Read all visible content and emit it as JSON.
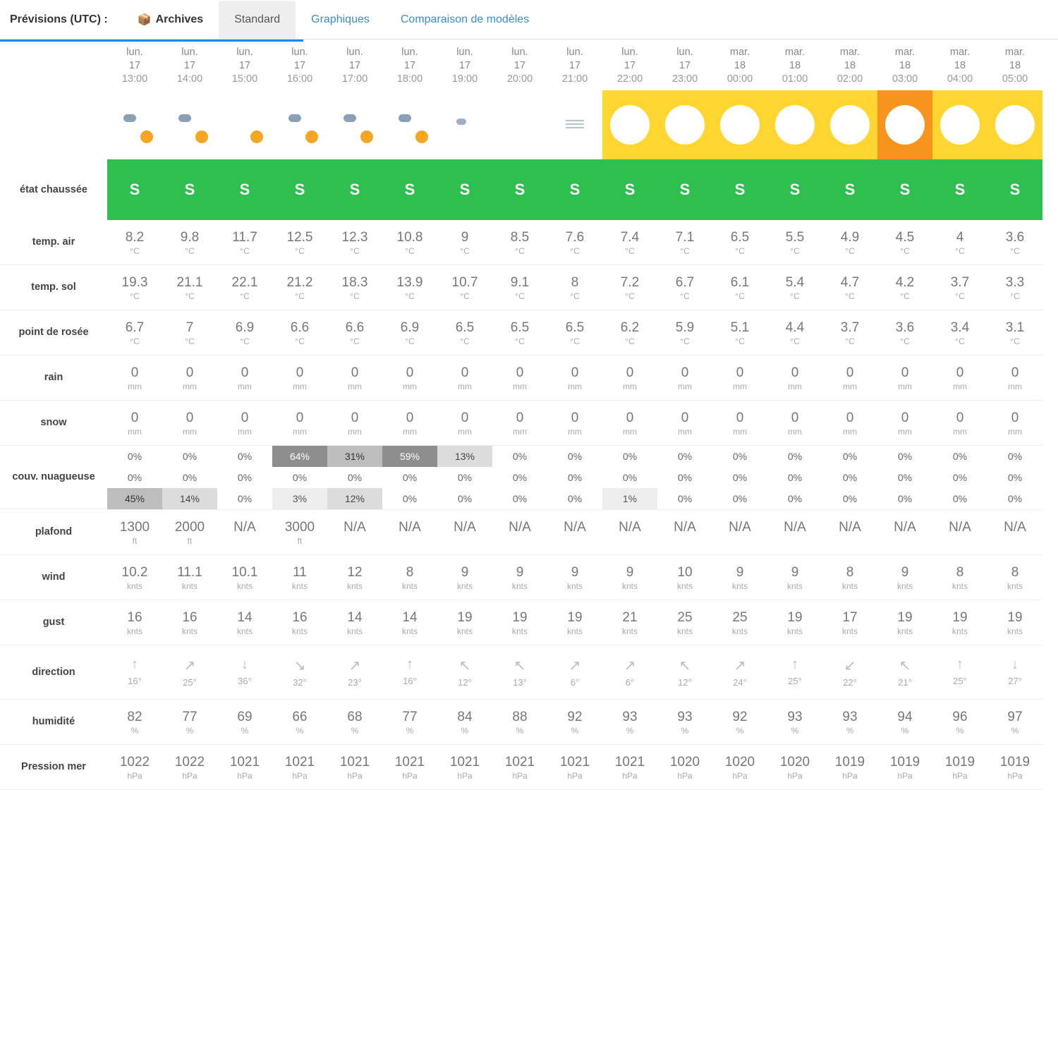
{
  "title": "Prévisions (UTC) :",
  "tabs": {
    "archives": "Archives",
    "standard": "Standard",
    "graphiques": "Graphiques",
    "comparaison": "Comparaison de modèles"
  },
  "headers": [
    {
      "day": "lun.",
      "date": "17",
      "time": "13:00"
    },
    {
      "day": "lun.",
      "date": "17",
      "time": "14:00"
    },
    {
      "day": "lun.",
      "date": "17",
      "time": "15:00"
    },
    {
      "day": "lun.",
      "date": "17",
      "time": "16:00"
    },
    {
      "day": "lun.",
      "date": "17",
      "time": "17:00"
    },
    {
      "day": "lun.",
      "date": "17",
      "time": "18:00"
    },
    {
      "day": "lun.",
      "date": "17",
      "time": "19:00"
    },
    {
      "day": "lun.",
      "date": "17",
      "time": "20:00"
    },
    {
      "day": "lun.",
      "date": "17",
      "time": "21:00"
    },
    {
      "day": "lun.",
      "date": "17",
      "time": "22:00"
    },
    {
      "day": "lun.",
      "date": "17",
      "time": "23:00"
    },
    {
      "day": "mar.",
      "date": "18",
      "time": "00:00"
    },
    {
      "day": "mar.",
      "date": "18",
      "time": "01:00"
    },
    {
      "day": "mar.",
      "date": "18",
      "time": "02:00"
    },
    {
      "day": "mar.",
      "date": "18",
      "time": "03:00"
    },
    {
      "day": "mar.",
      "date": "18",
      "time": "04:00"
    },
    {
      "day": "mar.",
      "date": "18",
      "time": "05:00"
    }
  ],
  "wx": [
    {
      "t": "sun-cloud",
      "bg": ""
    },
    {
      "t": "sun-cloud",
      "bg": ""
    },
    {
      "t": "sun",
      "bg": ""
    },
    {
      "t": "sun-cloud",
      "bg": ""
    },
    {
      "t": "sun-cloud",
      "bg": ""
    },
    {
      "t": "sun-cloud-fade",
      "bg": ""
    },
    {
      "t": "moon-cloud",
      "bg": ""
    },
    {
      "t": "moon",
      "bg": ""
    },
    {
      "t": "mist",
      "bg": ""
    },
    {
      "t": "moon",
      "bg": "night-y"
    },
    {
      "t": "moon",
      "bg": "night-y"
    },
    {
      "t": "moon",
      "bg": "night-y"
    },
    {
      "t": "moon",
      "bg": "night-y"
    },
    {
      "t": "moon",
      "bg": "night-y"
    },
    {
      "t": "moon-mist",
      "bg": "night-o"
    },
    {
      "t": "moon-mist",
      "bg": "night-y"
    },
    {
      "t": "moon-sun",
      "bg": "night-y"
    }
  ],
  "rows": {
    "road": {
      "label": "état chaussée",
      "vals": [
        "S",
        "S",
        "S",
        "S",
        "S",
        "S",
        "S",
        "S",
        "S",
        "S",
        "S",
        "S",
        "S",
        "S",
        "S",
        "S",
        "S"
      ]
    },
    "temp_air": {
      "label": "temp. air",
      "unit": "°C",
      "vals": [
        "8.2",
        "9.8",
        "11.7",
        "12.5",
        "12.3",
        "10.8",
        "9",
        "8.5",
        "7.6",
        "7.4",
        "7.1",
        "6.5",
        "5.5",
        "4.9",
        "4.5",
        "4",
        "3.6"
      ]
    },
    "temp_sol": {
      "label": "temp. sol",
      "unit": "°C",
      "vals": [
        "19.3",
        "21.1",
        "22.1",
        "21.2",
        "18.3",
        "13.9",
        "10.7",
        "9.1",
        "8",
        "7.2",
        "6.7",
        "6.1",
        "5.4",
        "4.7",
        "4.2",
        "3.7",
        "3.3"
      ]
    },
    "dewpoint": {
      "label": "point de rosée",
      "unit": "°C",
      "vals": [
        "6.7",
        "7",
        "6.9",
        "6.6",
        "6.6",
        "6.9",
        "6.5",
        "6.5",
        "6.5",
        "6.2",
        "5.9",
        "5.1",
        "4.4",
        "3.7",
        "3.6",
        "3.4",
        "3.1"
      ]
    },
    "rain": {
      "label": "rain",
      "unit": "mm",
      "vals": [
        "0",
        "0",
        "0",
        "0",
        "0",
        "0",
        "0",
        "0",
        "0",
        "0",
        "0",
        "0",
        "0",
        "0",
        "0",
        "0",
        "0"
      ]
    },
    "snow": {
      "label": "snow",
      "unit": "mm",
      "vals": [
        "0",
        "0",
        "0",
        "0",
        "0",
        "0",
        "0",
        "0",
        "0",
        "0",
        "0",
        "0",
        "0",
        "0",
        "0",
        "0",
        "0"
      ]
    },
    "cloud": {
      "label": "couv. nuagueuse",
      "high": [
        "0%",
        "0%",
        "0%",
        "64%",
        "31%",
        "59%",
        "13%",
        "0%",
        "0%",
        "0%",
        "0%",
        "0%",
        "0%",
        "0%",
        "0%",
        "0%",
        "0%"
      ],
      "mid": [
        "0%",
        "0%",
        "0%",
        "0%",
        "0%",
        "0%",
        "0%",
        "0%",
        "0%",
        "0%",
        "0%",
        "0%",
        "0%",
        "0%",
        "0%",
        "0%",
        "0%"
      ],
      "low": [
        "45%",
        "14%",
        "0%",
        "3%",
        "12%",
        "0%",
        "0%",
        "0%",
        "0%",
        "1%",
        "0%",
        "0%",
        "0%",
        "0%",
        "0%",
        "0%",
        "0%"
      ]
    },
    "ceiling": {
      "label": "plafond",
      "unit": "ft",
      "vals": [
        "1300",
        "2000",
        "N/A",
        "3000",
        "N/A",
        "N/A",
        "N/A",
        "N/A",
        "N/A",
        "N/A",
        "N/A",
        "N/A",
        "N/A",
        "N/A",
        "N/A",
        "N/A",
        "N/A"
      ]
    },
    "wind": {
      "label": "wind",
      "unit": "knts",
      "vals": [
        "10.2",
        "11.1",
        "10.1",
        "11",
        "12",
        "8",
        "9",
        "9",
        "9",
        "9",
        "10",
        "9",
        "9",
        "8",
        "9",
        "8",
        "8"
      ]
    },
    "gust": {
      "label": "gust",
      "unit": "knts",
      "vals": [
        "16",
        "16",
        "14",
        "16",
        "14",
        "14",
        "19",
        "19",
        "19",
        "21",
        "25",
        "25",
        "19",
        "17",
        "19",
        "19",
        "19"
      ]
    },
    "direction": {
      "label": "direction",
      "vals": [
        {
          "a": "↑",
          "d": "16°"
        },
        {
          "a": "↗",
          "d": "25°"
        },
        {
          "a": "↓",
          "d": "36°"
        },
        {
          "a": "↘",
          "d": "32°"
        },
        {
          "a": "↗",
          "d": "23°"
        },
        {
          "a": "↑",
          "d": "16°"
        },
        {
          "a": "↖",
          "d": "12°"
        },
        {
          "a": "↖",
          "d": "13°"
        },
        {
          "a": "↗",
          "d": "6°"
        },
        {
          "a": "↗",
          "d": "6°"
        },
        {
          "a": "↖",
          "d": "12°"
        },
        {
          "a": "↗",
          "d": "24°"
        },
        {
          "a": "↑",
          "d": "25°"
        },
        {
          "a": "↙",
          "d": "22°"
        },
        {
          "a": "↖",
          "d": "21°"
        },
        {
          "a": "↑",
          "d": "25°"
        },
        {
          "a": "↓",
          "d": "27°"
        }
      ]
    },
    "humidity": {
      "label": "humidité",
      "unit": "%",
      "vals": [
        "82",
        "77",
        "69",
        "66",
        "68",
        "77",
        "84",
        "88",
        "92",
        "93",
        "93",
        "92",
        "93",
        "93",
        "94",
        "96",
        "97"
      ]
    },
    "pressure": {
      "label": "Pression mer",
      "unit": "hPa",
      "vals": [
        "1022",
        "1022",
        "1021",
        "1021",
        "1021",
        "1021",
        "1021",
        "1021",
        "1021",
        "1021",
        "1020",
        "1020",
        "1020",
        "1019",
        "1019",
        "1019",
        "1019"
      ]
    }
  },
  "chart_data": {
    "type": "table",
    "title": "Prévisions météo horaires (UTC)",
    "x_headers": [
      "lun.17 13:00",
      "lun.17 14:00",
      "lun.17 15:00",
      "lun.17 16:00",
      "lun.17 17:00",
      "lun.17 18:00",
      "lun.17 19:00",
      "lun.17 20:00",
      "lun.17 21:00",
      "lun.17 22:00",
      "lun.17 23:00",
      "mar.18 00:00",
      "mar.18 01:00",
      "mar.18 02:00",
      "mar.18 03:00",
      "mar.18 04:00",
      "mar.18 05:00"
    ],
    "series": [
      {
        "name": "état chaussée",
        "values": [
          "S",
          "S",
          "S",
          "S",
          "S",
          "S",
          "S",
          "S",
          "S",
          "S",
          "S",
          "S",
          "S",
          "S",
          "S",
          "S",
          "S"
        ]
      },
      {
        "name": "temp. air (°C)",
        "values": [
          8.2,
          9.8,
          11.7,
          12.5,
          12.3,
          10.8,
          9,
          8.5,
          7.6,
          7.4,
          7.1,
          6.5,
          5.5,
          4.9,
          4.5,
          4,
          3.6
        ]
      },
      {
        "name": "temp. sol (°C)",
        "values": [
          19.3,
          21.1,
          22.1,
          21.2,
          18.3,
          13.9,
          10.7,
          9.1,
          8,
          7.2,
          6.7,
          6.1,
          5.4,
          4.7,
          4.2,
          3.7,
          3.3
        ]
      },
      {
        "name": "point de rosée (°C)",
        "values": [
          6.7,
          7,
          6.9,
          6.6,
          6.6,
          6.9,
          6.5,
          6.5,
          6.5,
          6.2,
          5.9,
          5.1,
          4.4,
          3.7,
          3.6,
          3.4,
          3.1
        ]
      },
      {
        "name": "rain (mm)",
        "values": [
          0,
          0,
          0,
          0,
          0,
          0,
          0,
          0,
          0,
          0,
          0,
          0,
          0,
          0,
          0,
          0,
          0
        ]
      },
      {
        "name": "snow (mm)",
        "values": [
          0,
          0,
          0,
          0,
          0,
          0,
          0,
          0,
          0,
          0,
          0,
          0,
          0,
          0,
          0,
          0,
          0
        ]
      },
      {
        "name": "couv. nuagueuse high (%)",
        "values": [
          0,
          0,
          0,
          64,
          31,
          59,
          13,
          0,
          0,
          0,
          0,
          0,
          0,
          0,
          0,
          0,
          0
        ]
      },
      {
        "name": "couv. nuagueuse mid (%)",
        "values": [
          0,
          0,
          0,
          0,
          0,
          0,
          0,
          0,
          0,
          0,
          0,
          0,
          0,
          0,
          0,
          0,
          0
        ]
      },
      {
        "name": "couv. nuagueuse low (%)",
        "values": [
          45,
          14,
          0,
          3,
          12,
          0,
          0,
          0,
          0,
          1,
          0,
          0,
          0,
          0,
          0,
          0,
          0
        ]
      },
      {
        "name": "plafond (ft)",
        "values": [
          1300,
          2000,
          null,
          3000,
          null,
          null,
          null,
          null,
          null,
          null,
          null,
          null,
          null,
          null,
          null,
          null,
          null
        ]
      },
      {
        "name": "wind (knts)",
        "values": [
          10.2,
          11.1,
          10.1,
          11,
          12,
          8,
          9,
          9,
          9,
          9,
          10,
          9,
          9,
          8,
          9,
          8,
          8
        ]
      },
      {
        "name": "gust (knts)",
        "values": [
          16,
          16,
          14,
          16,
          14,
          14,
          19,
          19,
          19,
          21,
          25,
          25,
          19,
          17,
          19,
          19,
          19
        ]
      },
      {
        "name": "direction (°)",
        "values": [
          16,
          25,
          36,
          32,
          23,
          16,
          12,
          13,
          6,
          6,
          12,
          24,
          25,
          22,
          21,
          25,
          27
        ]
      },
      {
        "name": "humidité (%)",
        "values": [
          82,
          77,
          69,
          66,
          68,
          77,
          84,
          88,
          92,
          93,
          93,
          92,
          93,
          93,
          94,
          96,
          97
        ]
      },
      {
        "name": "Pression mer (hPa)",
        "values": [
          1022,
          1022,
          1021,
          1021,
          1021,
          1021,
          1021,
          1021,
          1021,
          1021,
          1020,
          1020,
          1020,
          1019,
          1019,
          1019,
          1019
        ]
      }
    ]
  }
}
